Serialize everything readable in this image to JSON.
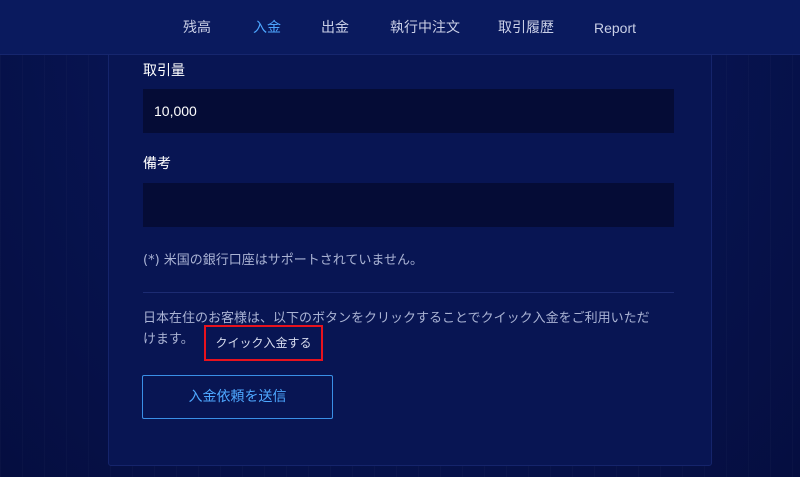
{
  "nav": {
    "items": [
      {
        "label": "残高",
        "active": false
      },
      {
        "label": "入金",
        "active": true
      },
      {
        "label": "出金",
        "active": false
      },
      {
        "label": "執行中注文",
        "active": false
      },
      {
        "label": "取引履歴",
        "active": false
      },
      {
        "label": "Report",
        "active": false
      }
    ]
  },
  "form": {
    "amount_label": "取引量",
    "amount_value": "10,000",
    "notes_label": "備考",
    "notes_value": "",
    "us_bank_note": "(*) 米国の銀行口座はサポートされていません。",
    "info_line_1": "日本在住のお客様は、以下のボタンをクリックすることでクイック入金をご利用いただ",
    "info_line_2": "けます。",
    "quick_deposit_label": "クイック入金する",
    "submit_label": "入金依頼を送信"
  },
  "colors": {
    "background": "#07114a",
    "active_nav": "#4da6ff",
    "highlight_border": "#e8121d",
    "button_border": "#3a8fe6"
  }
}
